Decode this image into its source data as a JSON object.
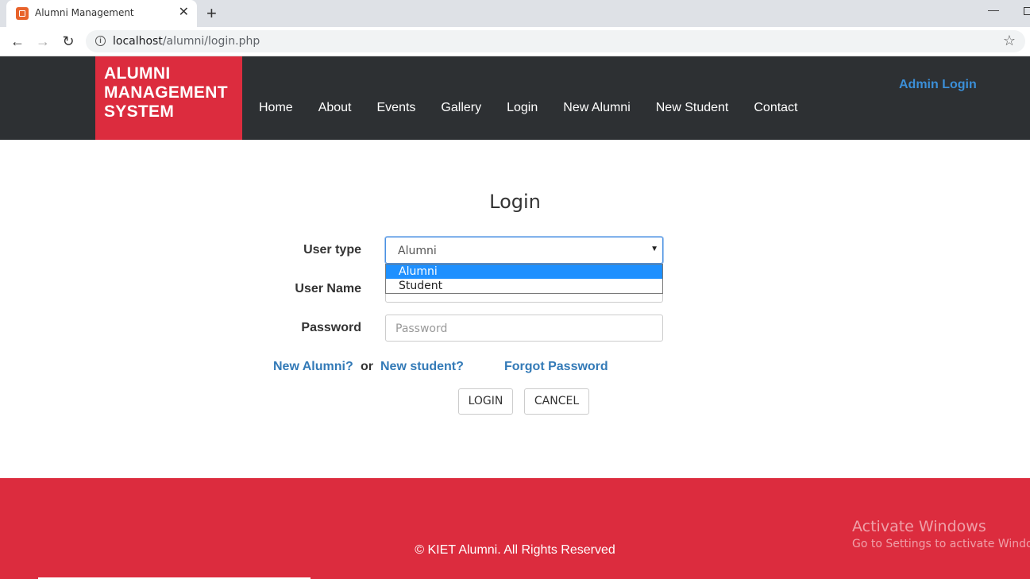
{
  "browser": {
    "tab_title": "Alumni Management",
    "tab_close": "✕",
    "new_tab": "+",
    "url_host": "localhost",
    "url_path": "/alumni/login.php",
    "back": "←",
    "forward": "→",
    "reload": "↻",
    "info": "i",
    "star": "☆",
    "minimize": "—"
  },
  "header": {
    "brand_lines": [
      "ALUMNI",
      "MANAGEMENT",
      "SYSTEM"
    ],
    "nav": [
      "Home",
      "About",
      "Events",
      "Gallery",
      "Login",
      "New Alumni",
      "New Student",
      "Contact"
    ],
    "admin_login": "Admin Login"
  },
  "form": {
    "title": "Login",
    "user_type_label": "User type",
    "user_type_value": "Alumni",
    "user_type_options": [
      "Alumni",
      "Student"
    ],
    "username_label": "User Name",
    "password_label": "Password",
    "password_placeholder": "Password",
    "new_alumni_link": "New Alumni?",
    "or_text": "or",
    "new_student_link": "New student?",
    "forgot_password": "Forgot Password",
    "login_button": "LOGIN",
    "cancel_button": "CANCEL",
    "arrow": "▼"
  },
  "footer": {
    "copyright": "© KIET Alumni. All Rights Reserved",
    "activate_title": "Activate Windows",
    "activate_sub": "Go to Settings to activate Windows."
  },
  "colors": {
    "brand_red": "#dc2c3e",
    "navbar_dark": "#2d3033",
    "link_blue": "#337ab7",
    "admin_blue": "#3b8fd8"
  }
}
